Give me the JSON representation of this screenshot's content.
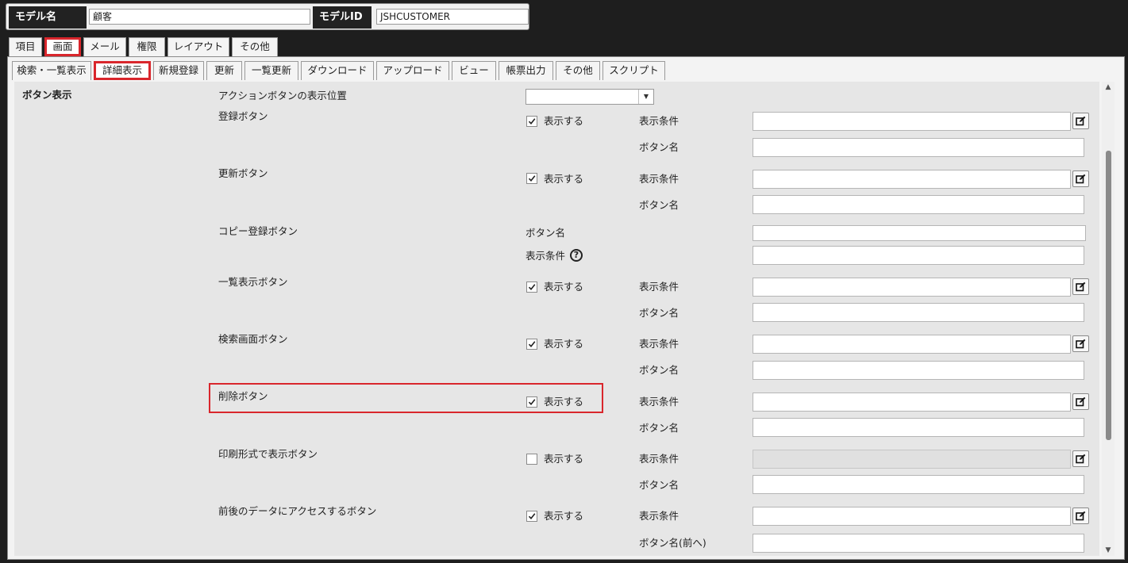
{
  "model_header": {
    "name_label": "モデル名",
    "name_value": "顧客",
    "id_label": "モデルID",
    "id_value": "JSHCUSTOMER"
  },
  "main_tabs": [
    "項目",
    "画面",
    "メール",
    "権限",
    "レイアウト",
    "その他"
  ],
  "main_tab_active": "画面",
  "sub_tabs": [
    "検索・一覧表示",
    "詳細表示",
    "新規登録",
    "更新",
    "一覧更新",
    "ダウンロード",
    "アップロード",
    "ビュー",
    "帳票出力",
    "その他",
    "スクリプト"
  ],
  "sub_tab_active": "詳細表示",
  "section": {
    "title": "ボタン表示",
    "position_label": "アクションボタンの表示位置",
    "position_value": ""
  },
  "labels": {
    "show": "表示する",
    "condition": "表示条件",
    "button_name": "ボタン名",
    "button_name_prev": "ボタン名(前へ)",
    "help": "?"
  },
  "buttons": [
    {
      "name": "登録ボタン",
      "checked": true
    },
    {
      "name": "更新ボタン",
      "checked": true
    },
    {
      "name": "コピー登録ボタン"
    },
    {
      "name": "一覧表示ボタン",
      "checked": true
    },
    {
      "name": "検索画面ボタン",
      "checked": true
    },
    {
      "name": "削除ボタン",
      "checked": true
    },
    {
      "name": "印刷形式で表示ボタン",
      "checked": false
    },
    {
      "name": "前後のデータにアクセスするボタン",
      "checked": true
    }
  ]
}
